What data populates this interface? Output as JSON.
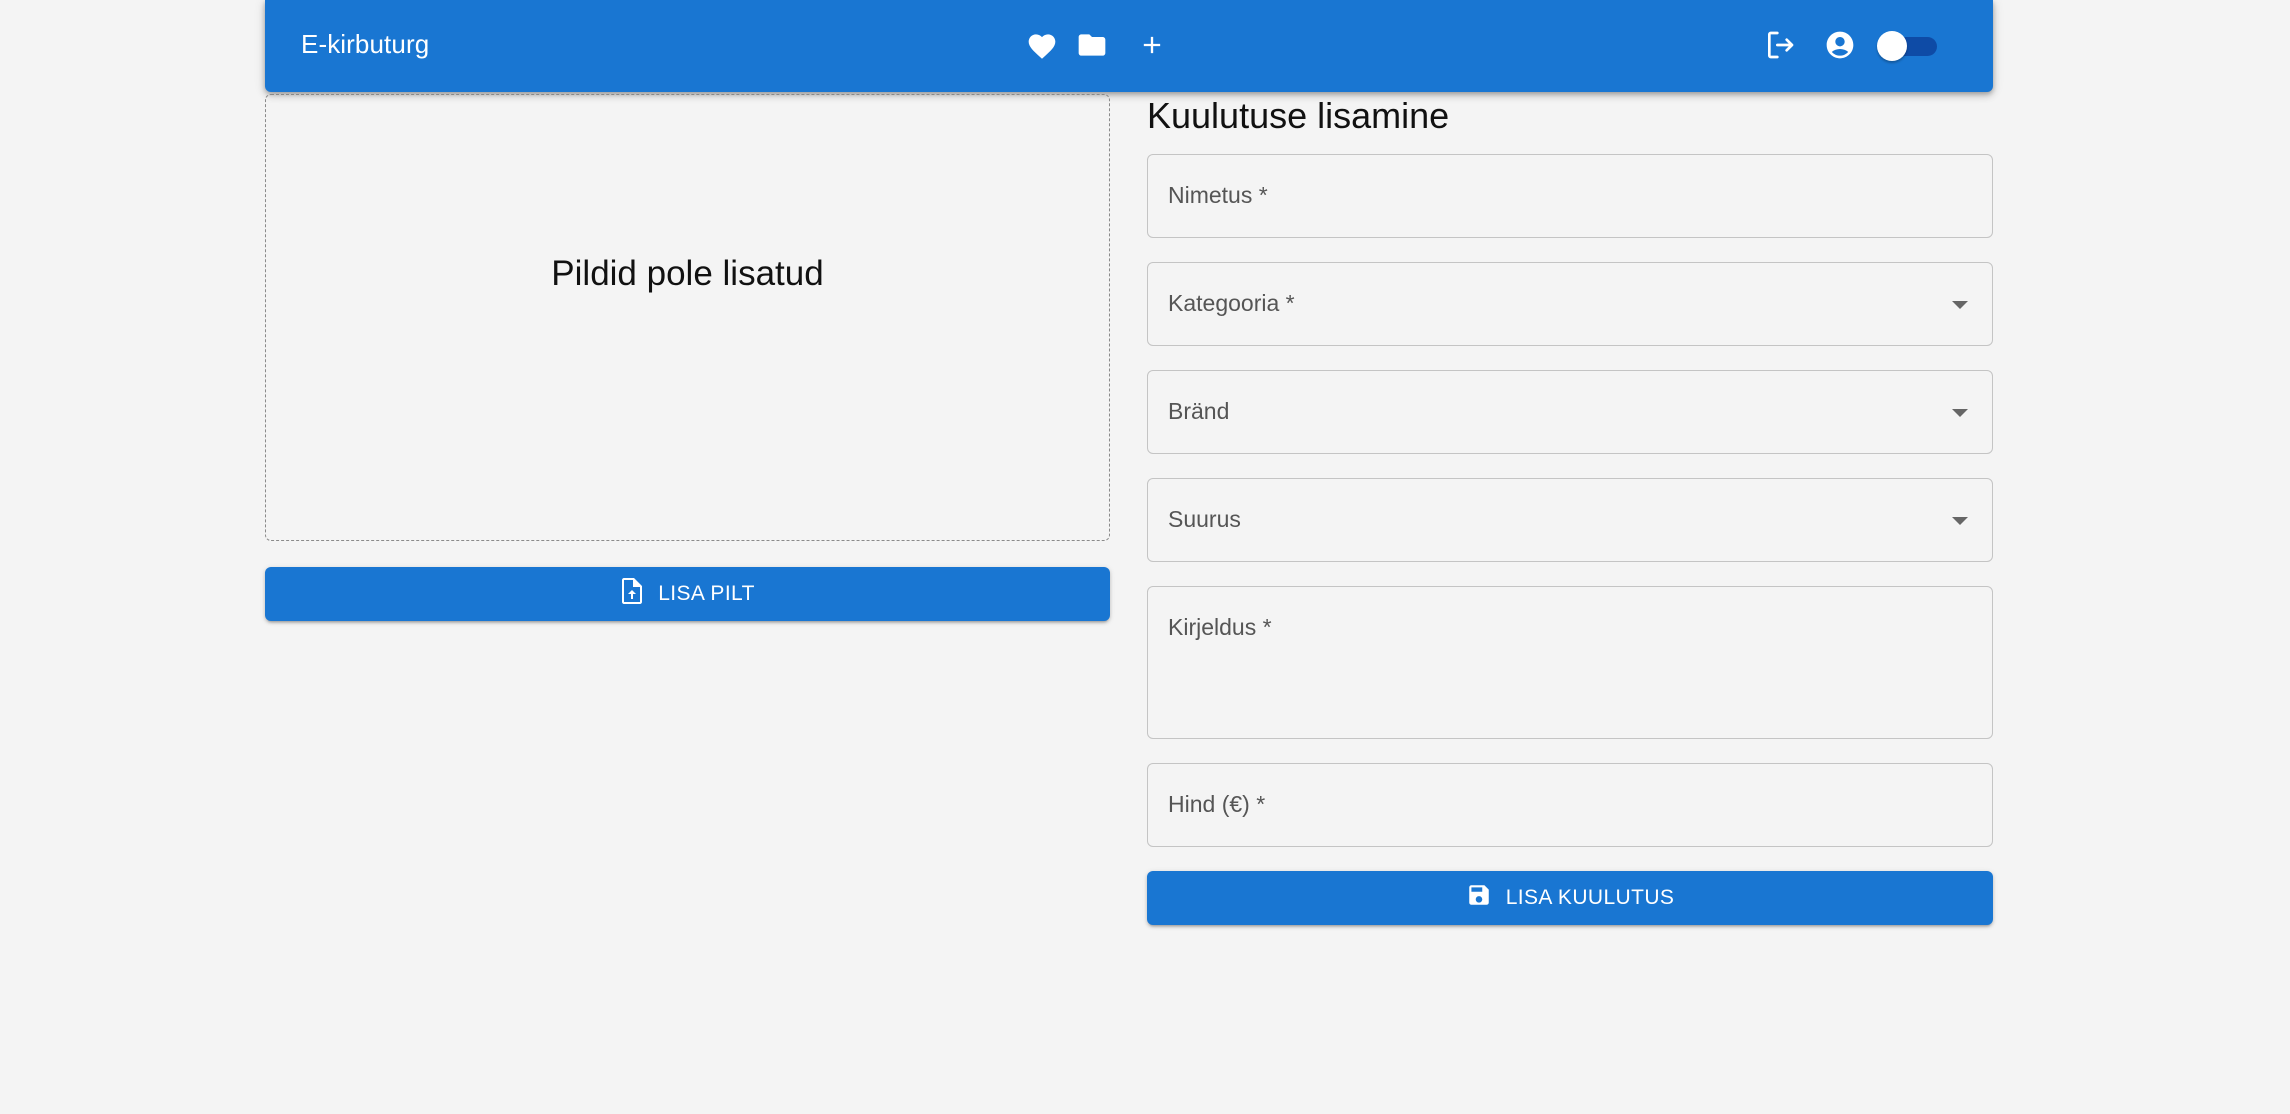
{
  "appbar": {
    "brand": "E-kirbuturg",
    "icons": [
      "heart-icon",
      "folder-icon",
      "plus-icon",
      "logout-icon",
      "account-circle-icon"
    ],
    "theme_toggle_on": false,
    "color": "#1976d2"
  },
  "images": {
    "empty_text": "Pildid pole lisatud",
    "add_button_label": "LISA PILT",
    "add_button_icon": "file-upload-icon"
  },
  "form": {
    "title": "Kuulutuse lisamine",
    "fields": {
      "name": {
        "label": "Nimetus *",
        "value": ""
      },
      "category": {
        "label": "Kategooria *",
        "value": ""
      },
      "brand": {
        "label": "Bränd",
        "value": ""
      },
      "size": {
        "label": "Suurus",
        "value": ""
      },
      "description": {
        "label": "Kirjeldus *",
        "value": ""
      },
      "price": {
        "label": "Hind (€) *",
        "value": ""
      }
    },
    "submit_label": "LISA KUULUTUS",
    "submit_icon": "save-icon"
  }
}
